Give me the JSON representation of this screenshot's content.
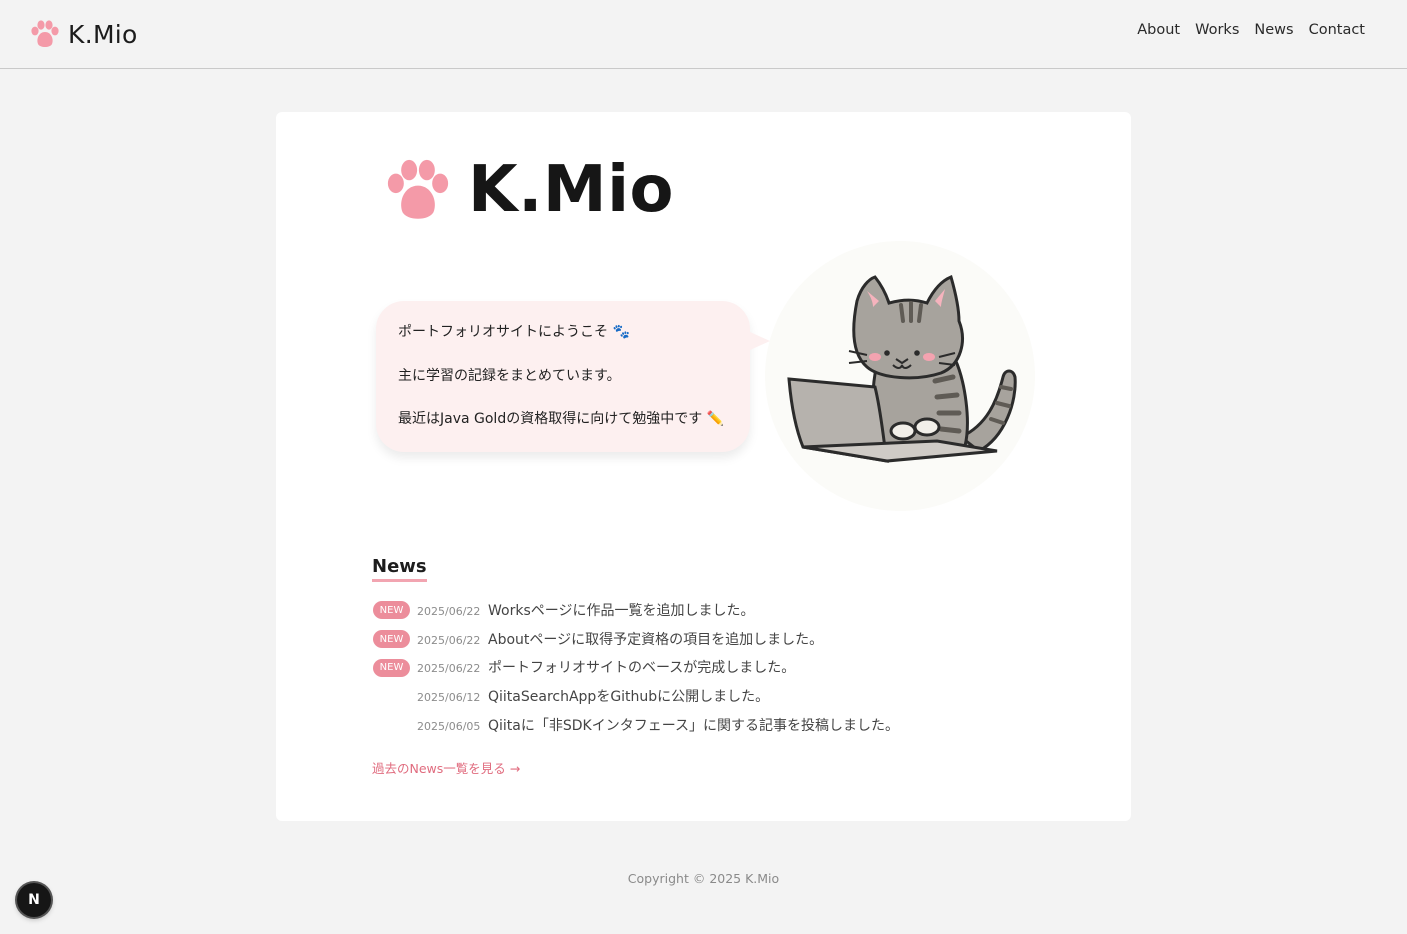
{
  "header": {
    "brand": "K.Mio",
    "nav": [
      "About",
      "Works",
      "News",
      "Contact"
    ]
  },
  "hero": {
    "title": "K.Mio",
    "bubble": [
      "ポートフォリオサイトにようこそ 🐾",
      "主に学習の記録をまとめています。",
      "最近はJava Goldの資格取得に向けて勉強中です ✏️"
    ]
  },
  "news": {
    "heading": "News",
    "badge_label": "NEW",
    "items": [
      {
        "is_new": true,
        "date": "2025/06/22",
        "text": "Worksページに作品一覧を追加しました。"
      },
      {
        "is_new": true,
        "date": "2025/06/22",
        "text": "Aboutページに取得予定資格の項目を追加しました。"
      },
      {
        "is_new": true,
        "date": "2025/06/22",
        "text": "ポートフォリオサイトのベースが完成しました。"
      },
      {
        "is_new": false,
        "date": "2025/06/12",
        "text": "QiitaSearchAppをGithubに公開しました。"
      },
      {
        "is_new": false,
        "date": "2025/06/05",
        "text": "Qiitaに「非SDKインタフェース」に関する記事を投稿しました。"
      }
    ],
    "more_link": "過去のNews一覧を見る →"
  },
  "footer": {
    "copyright": "Copyright © 2025 K.Mio"
  },
  "dev_badge": "N",
  "colors": {
    "accent_pink": "#ec8d9b",
    "paw_pink": "#f49aa8",
    "bubble_bg": "#fdf0f0",
    "page_bg": "#f3f3f3"
  }
}
